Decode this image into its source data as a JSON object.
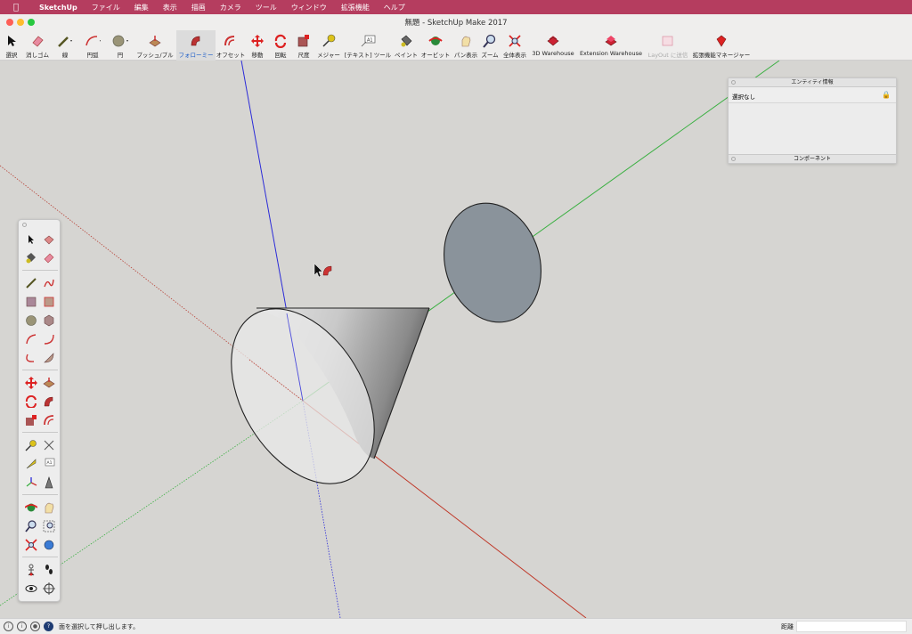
{
  "menubar": {
    "app": "SketchUp",
    "items": [
      "ファイル",
      "編集",
      "表示",
      "描画",
      "カメラ",
      "ツール",
      "ウィンドウ",
      "拡張機能",
      "ヘルプ"
    ]
  },
  "window": {
    "title": "無題 - SketchUp Make 2017"
  },
  "toolbar": {
    "items": [
      {
        "label": "選択",
        "icon": "select-arrow-icon"
      },
      {
        "label": "消しゴム",
        "icon": "eraser-icon"
      },
      {
        "label": "線",
        "icon": "pencil-icon"
      },
      {
        "label": "円弧",
        "icon": "arc-icon"
      },
      {
        "label": "円",
        "icon": "circle-icon"
      },
      {
        "label": "プッシュ/プル",
        "icon": "push-pull-icon"
      },
      {
        "label": "フォローミー",
        "icon": "follow-me-icon",
        "active": true
      },
      {
        "label": "オフセット",
        "icon": "offset-icon"
      },
      {
        "label": "移動",
        "icon": "move-icon"
      },
      {
        "label": "回転",
        "icon": "rotate-icon"
      },
      {
        "label": "尺度",
        "icon": "scale-icon"
      },
      {
        "label": "メジャー",
        "icon": "tape-measure-icon"
      },
      {
        "label": "[テキスト] ツール",
        "icon": "text-tool-icon"
      },
      {
        "label": "ペイント",
        "icon": "paint-bucket-icon"
      },
      {
        "label": "オービット",
        "icon": "orbit-icon"
      },
      {
        "label": "パン表示",
        "icon": "pan-icon"
      },
      {
        "label": "ズーム",
        "icon": "zoom-icon"
      },
      {
        "label": "全体表示",
        "icon": "zoom-extents-icon"
      },
      {
        "label": "3D Warehouse",
        "icon": "3d-warehouse-icon"
      },
      {
        "label": "Extension Warehouse",
        "icon": "extension-warehouse-icon"
      },
      {
        "label": "LayOut に送信",
        "icon": "send-to-layout-icon",
        "disabled": true
      },
      {
        "label": "拡張機能マネージャー",
        "icon": "extension-manager-icon"
      }
    ]
  },
  "entity_info": {
    "title": "エンティティ情報",
    "selection": "選択なし",
    "components_title": "コンポーネント"
  },
  "statusbar": {
    "message": "面を選択して押し出します。",
    "distance_label": "距離",
    "distance_value": ""
  },
  "colors": {
    "menubar": "#b53d5f",
    "axis_red": "#c0392b",
    "axis_green": "#3cb043",
    "axis_blue": "#2b2bd8",
    "face_shaded": "#8a939b",
    "accent": "#1a5cc9"
  }
}
